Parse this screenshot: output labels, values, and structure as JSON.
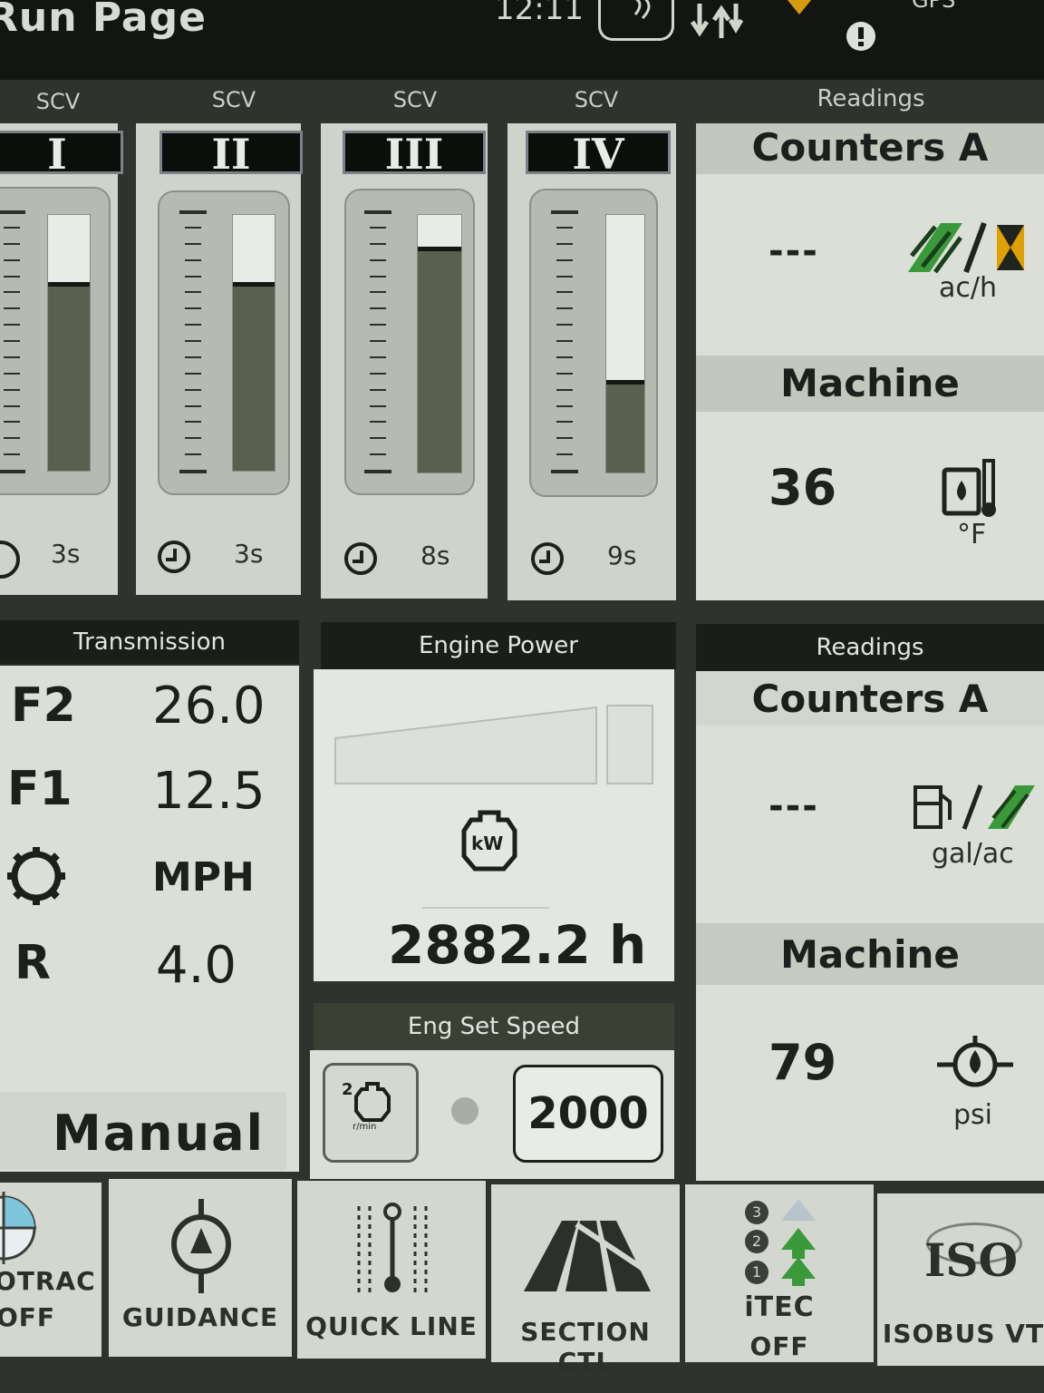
{
  "header": {
    "title": "Run Page",
    "clock": "12:11",
    "gps_label": "GPS"
  },
  "icons": {
    "signal": "signal-icon",
    "transfer": "transfer-arrows-icon",
    "warning": "warning-icon",
    "info": "info-icon",
    "timer": "timer-icon",
    "work_rate": "work-rate-icon",
    "hydraulic_temp": "oil-temperature-icon",
    "fuel_area": "fuel-per-area-icon",
    "oil_pressure": "oil-pressure-icon",
    "kw": "engine-kw-icon",
    "rpm": "engine-rpm-icon",
    "gear": "gear-icon"
  },
  "scv": [
    {
      "header": "SCV",
      "numeral": "I",
      "timer": "3s",
      "level": 0.72
    },
    {
      "header": "SCV",
      "numeral": "II",
      "timer": "3s",
      "level": 0.72
    },
    {
      "header": "SCV",
      "numeral": "III",
      "timer": "8s",
      "level": 0.86
    },
    {
      "header": "SCV",
      "numeral": "IV",
      "timer": "9s",
      "level": 0.34
    }
  ],
  "readings_top": {
    "header": "Readings",
    "counter_title": "Counters A",
    "counter_value": "---",
    "counter_unit": "ac/h",
    "machine_title": "Machine",
    "machine_value": "36",
    "machine_unit": "°F"
  },
  "readings_bottom": {
    "header": "Readings",
    "counter_title": "Counters A",
    "counter_value": "---",
    "counter_unit": "gal/ac",
    "machine_title": "Machine",
    "machine_value": "79",
    "machine_unit": "psi"
  },
  "transmission": {
    "header": "Transmission",
    "rows": [
      {
        "label": "F2",
        "value": "26.0"
      },
      {
        "label": "F1",
        "value": "12.5"
      },
      {
        "label": "",
        "value": "MPH"
      },
      {
        "label": "R",
        "value": "4.0"
      }
    ],
    "mode": "Manual"
  },
  "engine_power": {
    "header": "Engine Power",
    "kw_label": "kW",
    "hours": "2882.2 h"
  },
  "eng_set_speed": {
    "header": "Eng Set Speed",
    "preset_label": "2",
    "rpm_label": "r/min",
    "value": "2000"
  },
  "nav": [
    {
      "line1": "OTRAC",
      "line2": "OFF"
    },
    {
      "line1": "GUIDANCE",
      "line2": ""
    },
    {
      "line1": "QUICK LINE",
      "line2": ""
    },
    {
      "line1": "SECTION CTL",
      "line2": ""
    },
    {
      "line1": "iTEC",
      "line2": "OFF"
    },
    {
      "line1": "ISOBUS VT",
      "line2": ""
    }
  ],
  "nav_extra": {
    "iso_logo": "ISO",
    "itec_steps": [
      "3",
      "2",
      "1"
    ]
  },
  "colors": {
    "background": "#2e332d",
    "panel": "#dcdfd8",
    "gauge_fill": "#59604f",
    "accent_green": "#3a9a3a",
    "accent_yellow": "#e0a000"
  }
}
